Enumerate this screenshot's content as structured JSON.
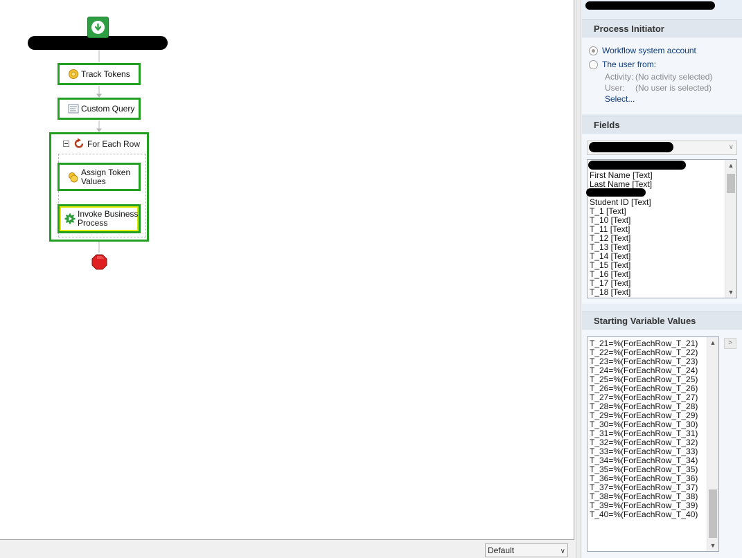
{
  "canvas": {
    "nodes": {
      "track_tokens": "Track Tokens",
      "custom_query": "Custom Query",
      "for_each_row": "For Each Row",
      "assign_token_values_line1": "Assign Token",
      "assign_token_values_line2": "Values",
      "invoke_bp_line1": "Invoke Business",
      "invoke_bp_line2": "Process"
    },
    "icons": {
      "start": "start-arrow-down-icon",
      "track_tokens": "token-icon",
      "custom_query": "query-icon",
      "for_each_row": "loop-icon",
      "assign_token_values": "coins-icon",
      "invoke_bp": "gear-play-icon",
      "stop": "stop-icon"
    },
    "colors": {
      "node_border": "#22a022",
      "selected_inner": "#e8e800",
      "start": "#2ea043",
      "stop": "#d32f2f"
    }
  },
  "footer": {
    "zoom_value": "Default"
  },
  "panel": {
    "process_initiator": {
      "title": "Process Initiator",
      "option_system": "Workflow system account",
      "option_user": "The user from:",
      "activity_label": "Activity:",
      "activity_value": "(No activity selected)",
      "user_label": "User:",
      "user_value": "(No user is selected)",
      "select_link": "Select..."
    },
    "fields": {
      "title": "Fields",
      "items": [
        "First Name [Text]",
        "Last Name [Text]",
        "",
        "Student ID [Text]",
        "T_1 [Text]",
        "T_10 [Text]",
        "T_11 [Text]",
        "T_12 [Text]",
        "T_13 [Text]",
        "T_14 [Text]",
        "T_15 [Text]",
        "T_16 [Text]",
        "T_17 [Text]",
        "T_18 [Text]"
      ]
    },
    "starting_variables": {
      "title": "Starting Variable Values",
      "items": [
        "T_21=%(ForEachRow_T_21)",
        "T_22=%(ForEachRow_T_22)",
        "T_23=%(ForEachRow_T_23)",
        "T_24=%(ForEachRow_T_24)",
        "T_25=%(ForEachRow_T_25)",
        "T_26=%(ForEachRow_T_26)",
        "T_27=%(ForEachRow_T_27)",
        "T_28=%(ForEachRow_T_28)",
        "T_29=%(ForEachRow_T_29)",
        "T_30=%(ForEachRow_T_30)",
        "T_31=%(ForEachRow_T_31)",
        "T_32=%(ForEachRow_T_32)",
        "T_33=%(ForEachRow_T_33)",
        "T_34=%(ForEachRow_T_34)",
        "T_35=%(ForEachRow_T_35)",
        "T_36=%(ForEachRow_T_36)",
        "T_37=%(ForEachRow_T_37)",
        "T_38=%(ForEachRow_T_38)",
        "T_39=%(ForEachRow_T_39)",
        "T_40=%(ForEachRow_T_40)"
      ],
      "side_button": ">"
    }
  }
}
